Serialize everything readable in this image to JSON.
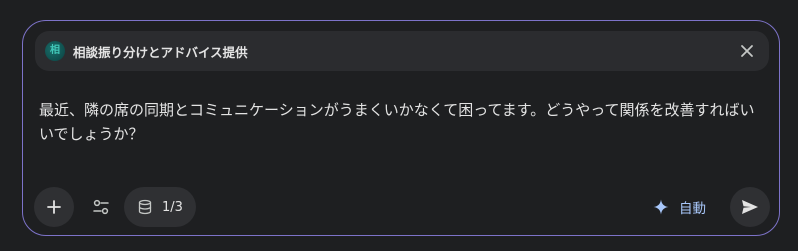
{
  "gem": {
    "avatar_char": "相",
    "name": "相談振り分けとアドバイス提供"
  },
  "prompt": {
    "text": "最近、隣の席の同期とコミュニケーションがうまくいかなくて困ってます。どうやって関係を改善すればいいでしょうか？"
  },
  "toolbar": {
    "source_count": "1/3",
    "mode_label": "自動"
  },
  "icons": {
    "close": "close-icon",
    "add": "plus-icon",
    "tools": "tune-icon",
    "source": "database-icon",
    "mode": "sparkle-icon",
    "send": "send-icon"
  },
  "colors": {
    "border": "#7d73c9",
    "accent": "#a8c7fa",
    "background": "#1e1f21",
    "chip": "#2b2c2f"
  }
}
